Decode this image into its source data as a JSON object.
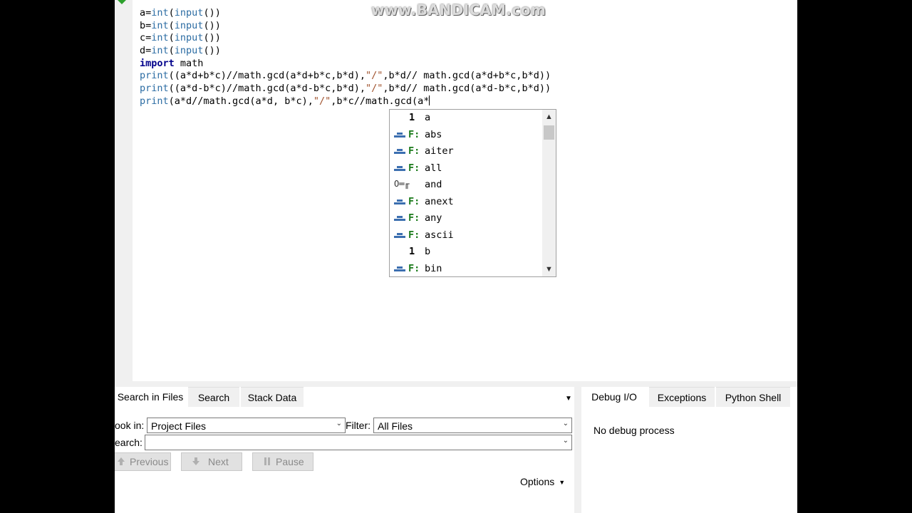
{
  "watermark": "www.BANDICAM.com",
  "editor": {
    "lines": [
      [
        {
          "t": "a="
        },
        {
          "t": "int",
          "c": "bi"
        },
        {
          "t": "("
        },
        {
          "t": "input",
          "c": "bi"
        },
        {
          "t": "())"
        }
      ],
      [
        {
          "t": "b="
        },
        {
          "t": "int",
          "c": "bi"
        },
        {
          "t": "("
        },
        {
          "t": "input",
          "c": "bi"
        },
        {
          "t": "())"
        }
      ],
      [
        {
          "t": "c="
        },
        {
          "t": "int",
          "c": "bi"
        },
        {
          "t": "("
        },
        {
          "t": "input",
          "c": "bi"
        },
        {
          "t": "())"
        }
      ],
      [
        {
          "t": "d="
        },
        {
          "t": "int",
          "c": "bi"
        },
        {
          "t": "("
        },
        {
          "t": "input",
          "c": "bi"
        },
        {
          "t": "())"
        }
      ],
      [
        {
          "t": "import",
          "c": "kw"
        },
        {
          "t": " math"
        }
      ],
      [
        {
          "t": "print",
          "c": "bi"
        },
        {
          "t": "((a*d+b*c)//math.gcd(a*d+b*c,b*d),"
        },
        {
          "t": "\"/\"",
          "c": "str"
        },
        {
          "t": ",b*d// math.gcd(a*d+b*c,b*d))"
        }
      ],
      [
        {
          "t": "print",
          "c": "bi"
        },
        {
          "t": "((a*d-b*c)//math.gcd(a*d-b*c,b*d),"
        },
        {
          "t": "\"/\"",
          "c": "str"
        },
        {
          "t": ",b*d// math.gcd(a*d-b*c,b*d))"
        }
      ],
      [
        {
          "t": "print",
          "c": "bi"
        },
        {
          "t": "(a*d//math.gcd(a*d, b*c),"
        },
        {
          "t": "\"/\"",
          "c": "str"
        },
        {
          "t": ",b*c//math.gcd(a*"
        }
      ]
    ]
  },
  "autocomplete": {
    "items": [
      {
        "kind": "1",
        "icon": "number",
        "label": "a"
      },
      {
        "kind": "F:",
        "icon": "function",
        "label": "abs"
      },
      {
        "kind": "F:",
        "icon": "function",
        "label": "aiter"
      },
      {
        "kind": "F:",
        "icon": "function",
        "label": "all"
      },
      {
        "kind": "",
        "icon": "keyword",
        "label": "and"
      },
      {
        "kind": "F:",
        "icon": "function",
        "label": "anext"
      },
      {
        "kind": "F:",
        "icon": "function",
        "label": "any"
      },
      {
        "kind": "F:",
        "icon": "function",
        "label": "ascii"
      },
      {
        "kind": "1",
        "icon": "number",
        "label": "b"
      },
      {
        "kind": "F:",
        "icon": "function",
        "label": "bin"
      }
    ]
  },
  "search_panel": {
    "tabs": [
      "Search in Files",
      "Search",
      "Stack Data"
    ],
    "look_in_label": "ook in:",
    "look_in_value": "Project Files",
    "filter_label": "Filter:",
    "filter_value": "All Files",
    "search_label": "earch:",
    "search_value": "",
    "previous": "Previous",
    "next": "Next",
    "pause": "Pause",
    "options": "Options"
  },
  "debug_panel": {
    "tabs": [
      "Debug I/O",
      "Exceptions",
      "Python Shell"
    ],
    "message": "No debug process"
  }
}
